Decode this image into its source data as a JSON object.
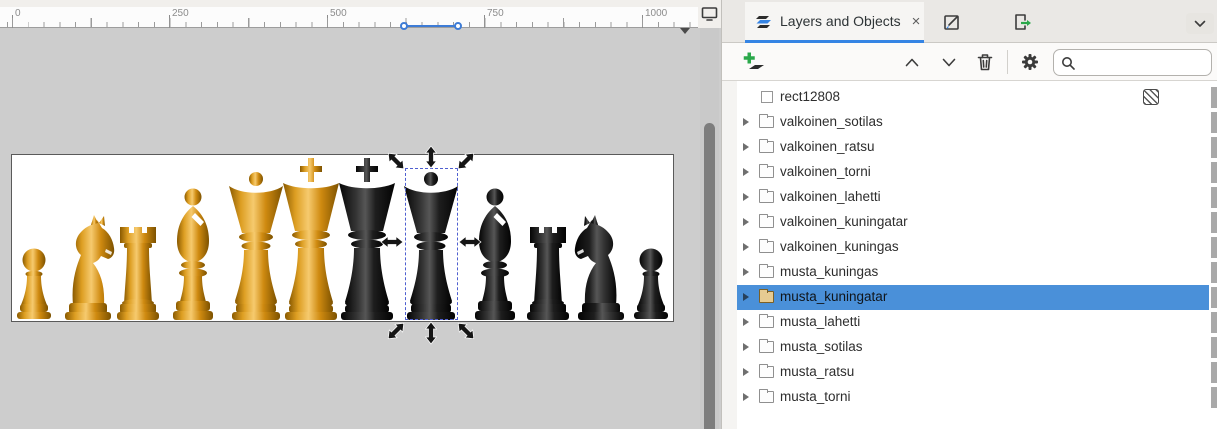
{
  "app": {
    "name_hint": "vector editor canvas with layers panel"
  },
  "ruler": {
    "labels": [
      "0",
      "250",
      "500",
      "750",
      "1000"
    ]
  },
  "canvas": {
    "pieces": [
      {
        "type": "pawn",
        "color": "gold"
      },
      {
        "type": "knight",
        "color": "gold"
      },
      {
        "type": "rook",
        "color": "gold"
      },
      {
        "type": "bishop",
        "color": "gold"
      },
      {
        "type": "queen",
        "color": "gold"
      },
      {
        "type": "king",
        "color": "gold"
      },
      {
        "type": "king",
        "color": "black"
      },
      {
        "type": "queen",
        "color": "black"
      },
      {
        "type": "bishop",
        "color": "black"
      },
      {
        "type": "rook",
        "color": "black"
      },
      {
        "type": "knight",
        "color": "black"
      },
      {
        "type": "pawn",
        "color": "black"
      }
    ],
    "selection": {
      "selected_piece": "black queen"
    }
  },
  "panel": {
    "tab_label": "Layers and Objects",
    "close_glyph": "×",
    "toolbar": {
      "search_placeholder": "",
      "search_value": ""
    },
    "rows": [
      {
        "label": "rect12808",
        "icon": "rect",
        "expandable": false,
        "selected": false,
        "badge": "hatch"
      },
      {
        "label": "valkoinen_sotilas",
        "icon": "folder",
        "expandable": true,
        "selected": false
      },
      {
        "label": "valkoinen_ratsu",
        "icon": "folder",
        "expandable": true,
        "selected": false
      },
      {
        "label": "valkoinen_torni",
        "icon": "folder",
        "expandable": true,
        "selected": false
      },
      {
        "label": "valkoinen_lahetti",
        "icon": "folder",
        "expandable": true,
        "selected": false
      },
      {
        "label": "valkoinen_kuningatar",
        "icon": "folder",
        "expandable": true,
        "selected": false
      },
      {
        "label": "valkoinen_kuningas",
        "icon": "folder",
        "expandable": true,
        "selected": false
      },
      {
        "label": "musta_kuningas",
        "icon": "folder",
        "expandable": true,
        "selected": false
      },
      {
        "label": "musta_kuningatar",
        "icon": "folder",
        "expandable": true,
        "selected": true
      },
      {
        "label": "musta_lahetti",
        "icon": "folder",
        "expandable": true,
        "selected": false
      },
      {
        "label": "musta_sotilas",
        "icon": "folder",
        "expandable": true,
        "selected": false
      },
      {
        "label": "musta_ratsu",
        "icon": "folder",
        "expandable": true,
        "selected": false
      },
      {
        "label": "musta_torni",
        "icon": "folder",
        "expandable": true,
        "selected": false
      }
    ]
  },
  "colors": {
    "accent_blue": "#3584e4",
    "selected_row_blue": "#4a90d9",
    "ruler_selection_blue": "#3e7cd6",
    "gold_piece": "#d6920f",
    "black_piece": "#141414",
    "canvas_gray": "#cdcdcd"
  }
}
